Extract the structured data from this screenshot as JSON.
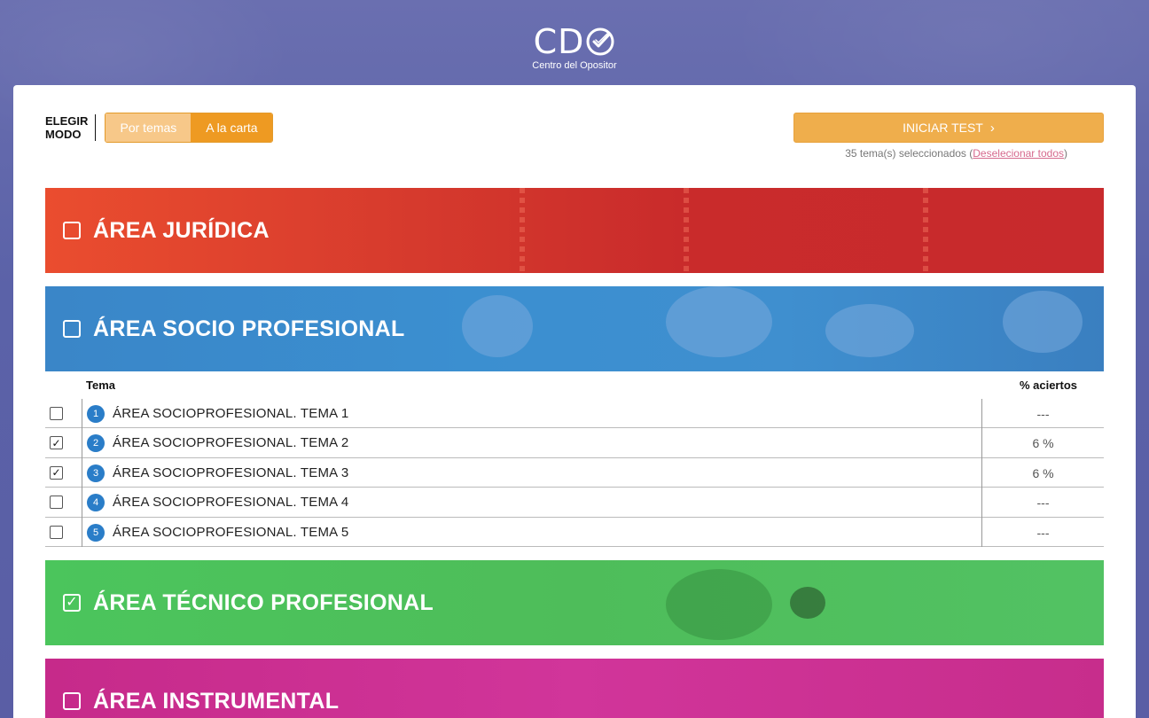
{
  "header": {
    "logo_text": "CD",
    "logo_subtitle": "Centro del Opositor"
  },
  "mode": {
    "label_line1": "ELEGIR",
    "label_line2": "MODO",
    "options": [
      "Por temas",
      "A la carta"
    ],
    "selected": "A la carta"
  },
  "actions": {
    "start_label": "INICIAR TEST",
    "selection_count_text": "35 tema(s) seleccionados (",
    "deselect_label": "Deselecionar todos",
    "selection_close": ")"
  },
  "areas": [
    {
      "title": "ÁREA JURÍDICA",
      "checked": false,
      "color": "#d63a2d"
    },
    {
      "title": "ÁREA SOCIO PROFESIONAL",
      "checked": false,
      "color": "#3b8fd0"
    },
    {
      "title": "ÁREA TÉCNICO PROFESIONAL",
      "checked": true,
      "color": "#4ebd5a"
    },
    {
      "title": "ÁREA INSTRUMENTAL",
      "checked": false,
      "color": "#d1359a"
    }
  ],
  "topics_table": {
    "col_topic": "Tema",
    "col_score": "% aciertos",
    "rows": [
      {
        "num": "1",
        "name": "ÁREA SOCIOPROFESIONAL. TEMA 1",
        "score": "---",
        "checked": false
      },
      {
        "num": "2",
        "name": "ÁREA SOCIOPROFESIONAL. TEMA 2",
        "score": "6 %",
        "checked": true
      },
      {
        "num": "3",
        "name": "ÁREA SOCIOPROFESIONAL. TEMA 3",
        "score": "6 %",
        "checked": true
      },
      {
        "num": "4",
        "name": "ÁREA SOCIOPROFESIONAL. TEMA 4",
        "score": "---",
        "checked": false
      },
      {
        "num": "5",
        "name": "ÁREA SOCIOPROFESIONAL. TEMA 5",
        "score": "---",
        "checked": false
      }
    ]
  },
  "colors": {
    "accent": "#ee9a22",
    "background": "#5b62a8",
    "badge": "#2a7dc8"
  }
}
